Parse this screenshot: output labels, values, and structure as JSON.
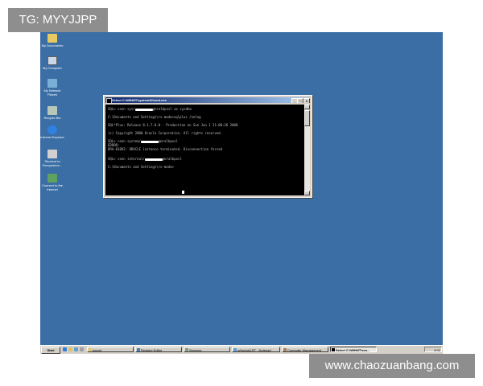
{
  "watermark_tag": "TG: MYYJJPP",
  "watermark_site": "www.chaozuanbang.com",
  "colors": {
    "desktop": "#3a6ea5",
    "console_bg": "#000000",
    "console_text": "#c0c0c0",
    "title_active": "#0a246a"
  },
  "desktop_icons": [
    {
      "label": "My Documents",
      "icon": "folder-icon"
    },
    {
      "label": "My Computer",
      "icon": "computer-icon"
    },
    {
      "label": "My Network Places",
      "icon": "network-icon"
    },
    {
      "label": "Recycle Bin",
      "icon": "recycle-bin-icon"
    },
    {
      "label": "Internet Explorer",
      "icon": "internet-explorer-icon"
    },
    {
      "label": "Shortcut to Everywhere...",
      "icon": "shortcut-icon"
    },
    {
      "label": "Connect to the Internet",
      "icon": "connect-icon"
    }
  ],
  "console": {
    "title": "Select C:\\WINNT\\system32\\cmd.exe",
    "buttons": {
      "minimize": "_",
      "maximize": "□",
      "close": "x"
    },
    "lines": [
      {
        "pre": "SQL> conn sys/",
        "post": "@oralbpxsl as sysdba",
        "redacted": true
      },
      {
        "pre": "C:\\Documents and Settings\\rs-mode>sqlplus /nolog",
        "post": "",
        "redacted": false
      },
      {
        "pre": "SQL*Plus: Release 8.1.7.0.0 - Production on Sun Jun 1 21:00:26 2008",
        "post": "",
        "redacted": false
      },
      {
        "pre": "(c) Copyright 2000 Oracle Corporation.  All rights reserved.",
        "post": "",
        "redacted": false
      },
      {
        "pre": "SQL> conn system/",
        "post": "@oralbpxsl",
        "redacted": true
      },
      {
        "pre": "ERROR:",
        "post": "",
        "redacted": false
      },
      {
        "pre": "ORA-01092: ORACLE instance terminated. Disconnection forced",
        "post": "",
        "redacted": false
      },
      {
        "pre": "SQL> conn internal/",
        "post": "@oralbpxsl",
        "redacted": true
      },
      {
        "pre": "C:\\Documents and Settings\\rs-mode>",
        "post": "",
        "redacted": false
      }
    ]
  },
  "taskbar": {
    "start_label": "Start",
    "tasks": [
      {
        "label": "export",
        "active": false
      },
      {
        "label": "Registry Editor",
        "active": false
      },
      {
        "label": "Services",
        "active": false
      },
      {
        "label": "orlbpxsALRT - Notepad",
        "active": false
      },
      {
        "label": "Computer Management",
        "active": false
      },
      {
        "label": "Select C:\\WINNT\\sys...",
        "active": true
      }
    ],
    "tray_time": "9:02"
  }
}
